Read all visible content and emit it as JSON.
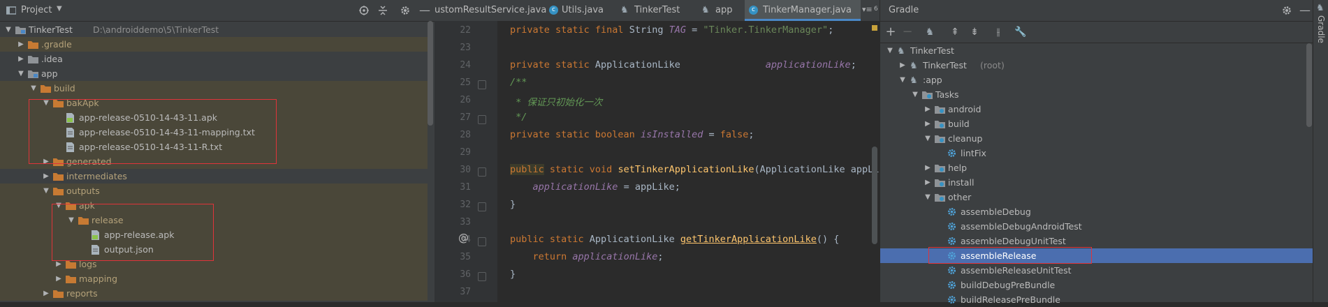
{
  "project": {
    "title": "Project",
    "tree": [
      {
        "label": "TinkerTest",
        "path": "D:\\androiddemo\\5\\TinkerTest",
        "level": 0,
        "open": true,
        "icon": "module"
      },
      {
        "label": ".gradle",
        "level": 1,
        "open": false,
        "icon": "folder-orange"
      },
      {
        "label": ".idea",
        "level": 1,
        "open": false,
        "icon": "folder"
      },
      {
        "label": "app",
        "level": 1,
        "open": true,
        "icon": "module"
      },
      {
        "label": "build",
        "level": 2,
        "open": true,
        "icon": "folder-orange"
      },
      {
        "label": "bakApk",
        "level": 3,
        "open": true,
        "icon": "folder-orange"
      },
      {
        "label": "app-release-0510-14-43-11.apk",
        "level": 4,
        "icon": "apk"
      },
      {
        "label": "app-release-0510-14-43-11-mapping.txt",
        "level": 4,
        "icon": "txt"
      },
      {
        "label": "app-release-0510-14-43-11-R.txt",
        "level": 4,
        "icon": "txt"
      },
      {
        "label": "generated",
        "level": 3,
        "open": false,
        "icon": "folder-orange"
      },
      {
        "label": "intermediates",
        "level": 3,
        "open": false,
        "icon": "folder-orange"
      },
      {
        "label": "outputs",
        "level": 3,
        "open": true,
        "icon": "folder-orange"
      },
      {
        "label": "apk",
        "level": 4,
        "open": true,
        "icon": "folder-orange"
      },
      {
        "label": "release",
        "level": 5,
        "open": true,
        "icon": "folder-orange"
      },
      {
        "label": "app-release.apk",
        "level": 6,
        "icon": "apk"
      },
      {
        "label": "output.json",
        "level": 6,
        "icon": "json"
      },
      {
        "label": "logs",
        "level": 4,
        "open": false,
        "icon": "folder-orange"
      },
      {
        "label": "mapping",
        "level": 4,
        "open": false,
        "icon": "folder-orange"
      },
      {
        "label": "reports",
        "level": 3,
        "open": false,
        "icon": "folder-orange"
      }
    ]
  },
  "tabs": [
    {
      "label": "ustomResultService.java",
      "icon": "java",
      "active": false
    },
    {
      "label": "Utils.java",
      "icon": "class",
      "active": false
    },
    {
      "label": "TinkerTest",
      "icon": "gradle",
      "active": false
    },
    {
      "label": "app",
      "icon": "gradle",
      "active": false
    },
    {
      "label": "TinkerManager.java",
      "icon": "class",
      "active": true
    }
  ],
  "tabs_overflow": "6",
  "editor": {
    "lines": [
      {
        "n": "22",
        "html": "<span class='kw'>private static final </span>String <span class='ital'>TAG</span> = <span class='str'>\"Tinker.TinkerManager\"</span>;"
      },
      {
        "n": "23",
        "html": ""
      },
      {
        "n": "24",
        "html": "<span class='kw'>private static </span>ApplicationLike               <span class='ital'>applicationLike</span>;"
      },
      {
        "n": "25",
        "html": "<span class='cmt'>/**</span>"
      },
      {
        "n": "26",
        "html": "<span class='cmt'> * 保证只初始化一次</span>"
      },
      {
        "n": "27",
        "html": "<span class='cmt'> */</span>"
      },
      {
        "n": "28",
        "html": "<span class='kw'>private static boolean </span><span class='ital'>isInstalled</span> = <span class='kw'>false</span>;"
      },
      {
        "n": "29",
        "html": ""
      },
      {
        "n": "30",
        "html": "<span class='kw' style='background:#3b3b2b'>public</span><span class='kw'> static void </span><span class='fn'>setTinkerApplicationLike</span>(ApplicationLike appLik"
      },
      {
        "n": "31",
        "html": "    <span class='ital'>applicationLike</span> = appLike;"
      },
      {
        "n": "32",
        "html": "}"
      },
      {
        "n": "33",
        "html": ""
      },
      {
        "n": "34",
        "html": "<span class='kw'>public static </span>ApplicationLike <span class='fn' style='text-decoration:underline'>getTinkerApplicationLike</span>() {"
      },
      {
        "n": "35",
        "html": "    <span class='kw'>return </span><span class='ital'>applicationLike</span>;"
      },
      {
        "n": "36",
        "html": "}"
      },
      {
        "n": "37",
        "html": ""
      }
    ]
  },
  "gradle": {
    "title": "Gradle",
    "side_label": "Gradle",
    "tree": [
      {
        "label": "TinkerTest",
        "level": 0,
        "open": true,
        "icon": "gradle"
      },
      {
        "label": "TinkerTest",
        "suffix": "(root)",
        "level": 1,
        "open": false,
        "icon": "gradle"
      },
      {
        "label": ":app",
        "level": 1,
        "open": true,
        "icon": "gradle"
      },
      {
        "label": "Tasks",
        "level": 2,
        "open": true,
        "icon": "folder-gear"
      },
      {
        "label": "android",
        "level": 3,
        "open": false,
        "icon": "folder-gear"
      },
      {
        "label": "build",
        "level": 3,
        "open": false,
        "icon": "folder-gear"
      },
      {
        "label": "cleanup",
        "level": 3,
        "open": true,
        "icon": "folder-gear"
      },
      {
        "label": "lintFix",
        "level": 4,
        "icon": "gear"
      },
      {
        "label": "help",
        "level": 3,
        "open": false,
        "icon": "folder-gear"
      },
      {
        "label": "install",
        "level": 3,
        "open": false,
        "icon": "folder-gear"
      },
      {
        "label": "other",
        "level": 3,
        "open": true,
        "icon": "folder-gear"
      },
      {
        "label": "assembleDebug",
        "level": 4,
        "icon": "gear"
      },
      {
        "label": "assembleDebugAndroidTest",
        "level": 4,
        "icon": "gear"
      },
      {
        "label": "assembleDebugUnitTest",
        "level": 4,
        "icon": "gear"
      },
      {
        "label": "assembleRelease",
        "level": 4,
        "icon": "gear",
        "selected": true
      },
      {
        "label": "assembleReleaseUnitTest",
        "level": 4,
        "icon": "gear"
      },
      {
        "label": "buildDebugPreBundle",
        "level": 4,
        "icon": "gear"
      },
      {
        "label": "buildReleasePreBundle",
        "level": 4,
        "icon": "gear"
      }
    ]
  },
  "colors": {
    "accent": "#4b6eaf",
    "highlight_box": "#e0343a",
    "folder": "#d08a3a"
  }
}
